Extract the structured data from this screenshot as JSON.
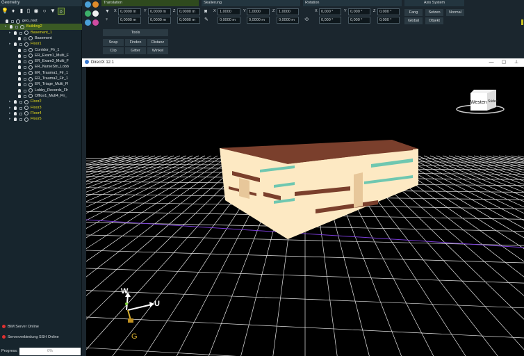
{
  "geometry_panel": {
    "title": "Geometry",
    "tree": [
      {
        "label": "geo_root",
        "color": "white"
      },
      {
        "label": "Building2",
        "color": "yellow"
      },
      {
        "label": "Basement_1",
        "color": "yellow"
      },
      {
        "label": "Basement",
        "color": "white"
      },
      {
        "label": "Floor1",
        "color": "yellow"
      },
      {
        "label": "Corridor_Flr_1",
        "color": "white"
      },
      {
        "label": "ER_Exam1_Multi_F",
        "color": "white"
      },
      {
        "label": "ER_Exam3_Multi_F",
        "color": "white"
      },
      {
        "label": "ER_NurseStn_Lobb",
        "color": "white"
      },
      {
        "label": "ER_Trauma1_Flr_1",
        "color": "white"
      },
      {
        "label": "ER_Trauma2_Flr_1",
        "color": "white"
      },
      {
        "label": "ER_Triage_Multi_Fl",
        "color": "white"
      },
      {
        "label": "Lobby_Records_Flr",
        "color": "white"
      },
      {
        "label": "Office1_Mult4_Flr_",
        "color": "white"
      },
      {
        "label": "Floor2",
        "color": "yellow"
      },
      {
        "label": "Floor3",
        "color": "yellow"
      },
      {
        "label": "Floor4",
        "color": "yellow"
      },
      {
        "label": "Floor5",
        "color": "yellow"
      }
    ]
  },
  "status": {
    "bim_server": "BIM Server Online",
    "ssh": "Serververbindung SSH Online",
    "progress_label": "Progress:",
    "progress_value": "0%"
  },
  "translation": {
    "title": "Translation",
    "x": "0,0000 m",
    "y": "0,0000 m",
    "z": "0,0000 m",
    "x2": "0,0000 m",
    "y2": "0,0000 m",
    "z2": "0,0000 m"
  },
  "scale": {
    "title": "Skalierung",
    "x": "1,0000",
    "y": "1,0000",
    "z": "1,0000",
    "x2": "0,0000 m",
    "y2": "0,0000 m",
    "z2": "0,0000 m"
  },
  "rotation": {
    "title": "Rotation",
    "x": "0,000 °",
    "y": "0,000 °",
    "z": "0,000 °",
    "x2": "0,000 °",
    "y2": "0,000 °",
    "z2": "0,000 °"
  },
  "axis_system": {
    "title": "Axis System",
    "buttons": [
      "Fang",
      "Setzen",
      "Normal",
      "Global",
      "Objekt"
    ]
  },
  "tools": {
    "title": "Tools",
    "buttons": [
      "Snap",
      "Finden",
      "Distanz",
      "Clip",
      "Gitter",
      "Winkel"
    ]
  },
  "labels": {
    "x": "X",
    "y": "Y",
    "z": "Z"
  },
  "viewport": {
    "title": "DirectX 12.1",
    "cube_face_west": "Westen",
    "cube_face_south": "Süden",
    "gizmo_w": "W",
    "gizmo_u": "U",
    "gizmo_g": "G"
  },
  "colors": {
    "panel_bg": "#1b262e",
    "accent_green": "#7ea33a",
    "tree_yellow": "#e5dc1c",
    "building_face": "#fde9c3",
    "building_roof": "#7a3f2c",
    "status_red": "#e03030"
  }
}
